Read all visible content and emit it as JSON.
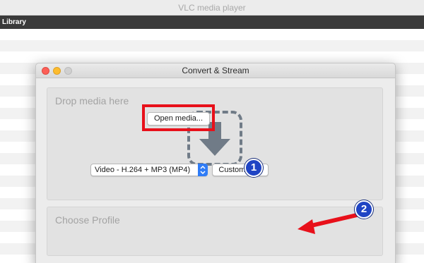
{
  "background_app": {
    "title": "VLC media player",
    "menu_label": "Library"
  },
  "dialog": {
    "title": "Convert & Stream",
    "window_buttons": [
      "close",
      "minimize",
      "zoom"
    ],
    "drop_section": {
      "label": "Drop media here",
      "icon": "download-arrow-icon",
      "open_button_label": "Open media..."
    },
    "profile_section": {
      "label": "Choose Profile",
      "selected_profile": "Video - H.264 + MP3 (MP4)",
      "customize_button_label": "Customize..."
    }
  },
  "annotations": {
    "step_1": "1",
    "step_2": "2",
    "highlight_color": "#e8101a",
    "badge_color": "#1f44c4"
  },
  "colors": {
    "accent_blue": "#2f7cf6",
    "traffic_red": "#fc5f57",
    "traffic_yellow": "#fdbc2e"
  }
}
